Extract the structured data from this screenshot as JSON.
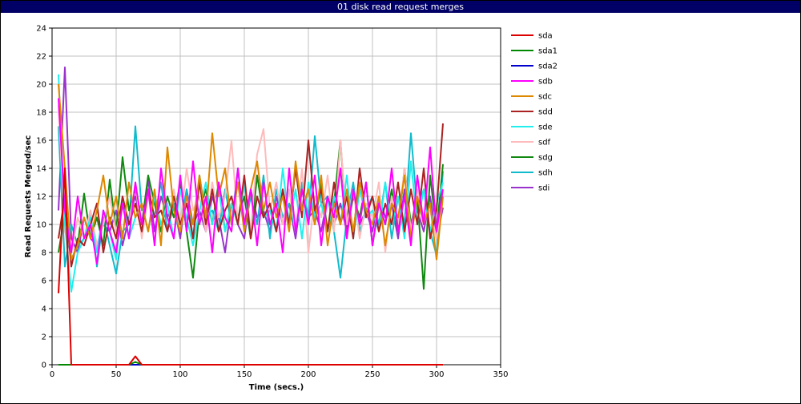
{
  "window": {
    "title": "01 disk read request merges"
  },
  "chart_data": {
    "type": "line",
    "title": "01 disk read request merges",
    "xlabel": "Time (secs.)",
    "ylabel": "Read Requests Merged/sec",
    "xlim": [
      0,
      350
    ],
    "ylim": [
      0,
      24
    ],
    "xticks": [
      0,
      50,
      100,
      150,
      200,
      250,
      300,
      350
    ],
    "yticks": [
      0,
      2,
      4,
      6,
      8,
      10,
      12,
      14,
      16,
      18,
      20,
      22,
      24
    ],
    "grid": true,
    "legend_position": "right",
    "x": [
      5,
      10,
      15,
      20,
      25,
      30,
      35,
      40,
      45,
      50,
      55,
      60,
      65,
      70,
      75,
      80,
      85,
      90,
      95,
      100,
      105,
      110,
      115,
      120,
      125,
      130,
      135,
      140,
      145,
      150,
      155,
      160,
      165,
      170,
      175,
      180,
      185,
      190,
      195,
      200,
      205,
      210,
      215,
      220,
      225,
      230,
      235,
      240,
      245,
      250,
      255,
      260,
      265,
      270,
      275,
      280,
      285,
      290,
      295,
      300,
      305
    ],
    "series": [
      {
        "name": "sda",
        "color": "#dd0000",
        "values": [
          5.1,
          14.0,
          0,
          0,
          0,
          0,
          0,
          0,
          0,
          0,
          0,
          0,
          0.6,
          0,
          0,
          0,
          0,
          0,
          0,
          0,
          0,
          0,
          0,
          0,
          0,
          0,
          0,
          0,
          0,
          0,
          0,
          0,
          0,
          0,
          0,
          0,
          0,
          0,
          0,
          0,
          0,
          0,
          0,
          0,
          0,
          0,
          0,
          0,
          0,
          0,
          0,
          0,
          0,
          0,
          0,
          0,
          0,
          0,
          0,
          0,
          0
        ]
      },
      {
        "name": "sda1",
        "color": "#008800",
        "values": [
          0,
          0,
          0,
          0,
          0,
          0,
          0,
          0,
          0,
          0,
          0,
          0,
          0.2,
          0,
          0,
          0,
          0,
          0,
          0,
          0,
          0,
          0,
          0,
          0,
          0,
          0,
          0,
          0,
          0,
          0,
          0,
          0,
          0,
          0,
          0,
          0,
          0,
          0,
          0,
          0,
          0,
          0,
          0,
          0,
          0,
          0,
          0,
          0,
          0,
          0,
          0,
          0,
          0,
          0,
          0,
          0,
          0,
          0,
          0,
          0,
          0
        ]
      },
      {
        "name": "sda2",
        "color": "#0000cc",
        "values": [
          0,
          0,
          0,
          0,
          0,
          0,
          0,
          0,
          0,
          0,
          0,
          0,
          0,
          0,
          0,
          0,
          0,
          0,
          0,
          0,
          0,
          0,
          0,
          0,
          0,
          0,
          0,
          0,
          0,
          0,
          0,
          0,
          0,
          0,
          0,
          0,
          0,
          0,
          0,
          0,
          0,
          0,
          0,
          0,
          0,
          0,
          0,
          0,
          0,
          0,
          0,
          0,
          0,
          0,
          0,
          0,
          0,
          0,
          0,
          0,
          0
        ]
      },
      {
        "name": "sdb",
        "color": "#ff00ff",
        "values": [
          19.0,
          11.0,
          8.0,
          12.0,
          9.0,
          10.0,
          7.2,
          11.0,
          9.5,
          8.0,
          11.5,
          9.0,
          13.0,
          10.0,
          12.5,
          8.5,
          14.0,
          10.5,
          9.0,
          13.5,
          9.5,
          14.5,
          10.0,
          12.0,
          8.0,
          13.0,
          10.5,
          9.5,
          14.0,
          10.0,
          12.5,
          8.5,
          13.0,
          10.0,
          11.5,
          8.0,
          14.0,
          9.5,
          12.5,
          10.0,
          13.5,
          8.5,
          12.0,
          10.5,
          14.0,
          9.0,
          12.5,
          10.0,
          13.0,
          8.5,
          11.5,
          10.0,
          14.0,
          9.5,
          12.0,
          8.5,
          13.5,
          10.0,
          15.5,
          9.5,
          12.5
        ]
      },
      {
        "name": "sdc",
        "color": "#dd8800",
        "values": [
          20.0,
          14.0,
          7.5,
          8.5,
          10.5,
          9.0,
          11.0,
          13.5,
          10.0,
          12.0,
          9.0,
          13.0,
          10.5,
          11.5,
          9.5,
          12.5,
          8.5,
          15.5,
          11.0,
          9.5,
          12.0,
          10.0,
          13.5,
          10.5,
          16.5,
          12.0,
          14.0,
          10.0,
          13.0,
          9.5,
          12.5,
          14.5,
          11.0,
          13.0,
          10.5,
          12.0,
          9.5,
          14.5,
          11.0,
          12.5,
          10.0,
          13.5,
          8.5,
          11.5,
          10.0,
          12.5,
          9.5,
          13.0,
          11.0,
          10.0,
          12.0,
          8.5,
          11.5,
          10.5,
          13.5,
          9.0,
          12.0,
          10.0,
          11.5,
          7.5,
          12.0
        ]
      },
      {
        "name": "sdd",
        "color": "#aa2222",
        "values": [
          9.0,
          12.0,
          7.0,
          9.0,
          8.5,
          10.0,
          11.5,
          8.0,
          10.5,
          9.0,
          12.0,
          10.0,
          11.5,
          9.5,
          12.5,
          10.5,
          11.0,
          9.5,
          12.0,
          10.0,
          11.5,
          9.0,
          13.0,
          10.0,
          12.5,
          9.5,
          11.0,
          12.0,
          10.0,
          13.5,
          9.0,
          12.0,
          10.5,
          11.5,
          9.5,
          12.5,
          10.0,
          14.0,
          10.5,
          16.0,
          11.0,
          12.5,
          9.5,
          13.0,
          10.0,
          12.0,
          9.0,
          14.0,
          10.5,
          12.0,
          9.5,
          11.5,
          10.0,
          13.0,
          9.5,
          12.5,
          10.0,
          14.0,
          9.0,
          11.0,
          17.2
        ]
      },
      {
        "name": "sde",
        "color": "#22eeee",
        "values": [
          20.7,
          10.0,
          5.2,
          8.0,
          9.0,
          10.5,
          8.0,
          11.0,
          9.5,
          7.5,
          12.0,
          9.0,
          10.5,
          11.5,
          9.5,
          12.0,
          10.0,
          11.5,
          9.0,
          12.5,
          10.5,
          8.5,
          11.0,
          13.0,
          10.0,
          12.5,
          9.5,
          11.5,
          10.0,
          13.0,
          9.0,
          12.0,
          10.5,
          11.0,
          9.5,
          14.0,
          10.0,
          12.5,
          9.0,
          13.0,
          10.5,
          11.5,
          9.5,
          12.0,
          10.0,
          13.5,
          9.0,
          12.5,
          10.5,
          11.0,
          9.5,
          13.0,
          10.0,
          12.0,
          9.0,
          14.5,
          10.0,
          12.5,
          9.5,
          11.5,
          13.0
        ]
      },
      {
        "name": "sdf",
        "color": "#ffbbbb",
        "values": [
          18.5,
          9.5,
          8.0,
          10.5,
          9.0,
          11.0,
          8.5,
          10.0,
          12.0,
          9.5,
          11.5,
          10.0,
          13.0,
          9.0,
          12.0,
          10.5,
          11.0,
          9.5,
          12.5,
          10.0,
          14.0,
          11.0,
          12.0,
          9.5,
          13.0,
          10.5,
          12.0,
          16.0,
          10.0,
          13.5,
          9.5,
          15.0,
          16.8,
          11.0,
          13.0,
          10.0,
          12.5,
          9.5,
          14.0,
          8.0,
          12.0,
          10.5,
          13.5,
          9.5,
          16.0,
          10.0,
          12.5,
          9.0,
          11.5,
          10.5,
          13.0,
          8.0,
          12.0,
          10.0,
          14.0,
          9.5,
          12.5,
          10.5,
          11.0,
          9.0,
          12.0
        ]
      },
      {
        "name": "sdg",
        "color": "#118811",
        "values": [
          8.0,
          10.8,
          7.5,
          8.5,
          12.2,
          9.0,
          10.5,
          8.5,
          13.2,
          9.5,
          14.8,
          11.0,
          12.5,
          10.0,
          13.5,
          11.5,
          9.5,
          12.0,
          10.5,
          13.0,
          9.5,
          6.2,
          11.0,
          12.5,
          10.0,
          13.0,
          9.5,
          11.5,
          10.5,
          12.0,
          9.0,
          13.5,
          10.5,
          11.0,
          9.5,
          12.5,
          10.0,
          14.0,
          11.0,
          12.5,
          10.0,
          13.0,
          9.5,
          11.5,
          16.0,
          9.5,
          12.0,
          10.5,
          13.0,
          8.5,
          11.5,
          10.0,
          12.5,
          9.5,
          14.0,
          10.0,
          12.0,
          5.4,
          13.5,
          9.5,
          14.3
        ]
      },
      {
        "name": "sdh",
        "color": "#11bbcc",
        "values": [
          17.0,
          7.0,
          10.0,
          8.5,
          9.0,
          11.0,
          7.0,
          10.5,
          8.5,
          6.5,
          9.5,
          10.0,
          17.0,
          11.0,
          12.0,
          10.5,
          13.0,
          9.5,
          11.5,
          10.0,
          12.5,
          9.0,
          13.5,
          10.5,
          11.0,
          9.5,
          12.5,
          10.0,
          14.0,
          9.5,
          12.0,
          10.0,
          13.5,
          9.0,
          12.5,
          10.5,
          11.5,
          9.5,
          13.0,
          10.5,
          16.3,
          11.5,
          12.0,
          9.5,
          6.2,
          10.5,
          13.0,
          9.5,
          11.0,
          12.0,
          10.0,
          13.0,
          9.0,
          12.0,
          10.0,
          16.5,
          11.0,
          12.5,
          9.5,
          7.8,
          13.8
        ]
      },
      {
        "name": "sdi",
        "color": "#9933cc",
        "values": [
          11.0,
          21.2,
          9.0,
          8.0,
          10.5,
          9.0,
          8.5,
          10.0,
          9.5,
          11.0,
          8.5,
          10.5,
          12.0,
          10.0,
          13.2,
          9.5,
          12.0,
          10.5,
          11.5,
          9.0,
          12.5,
          10.0,
          11.0,
          9.5,
          12.0,
          10.5,
          8.0,
          11.5,
          10.0,
          9.0,
          12.5,
          10.5,
          11.0,
          9.5,
          12.0,
          10.0,
          11.5,
          9.0,
          12.5,
          10.5,
          11.0,
          9.5,
          12.0,
          10.0,
          11.5,
          9.5,
          12.5,
          10.0,
          11.0,
          9.5,
          12.0,
          10.5,
          11.5,
          9.0,
          12.5,
          10.0,
          11.0,
          9.5,
          12.0,
          9.0,
          11.2
        ]
      }
    ]
  }
}
